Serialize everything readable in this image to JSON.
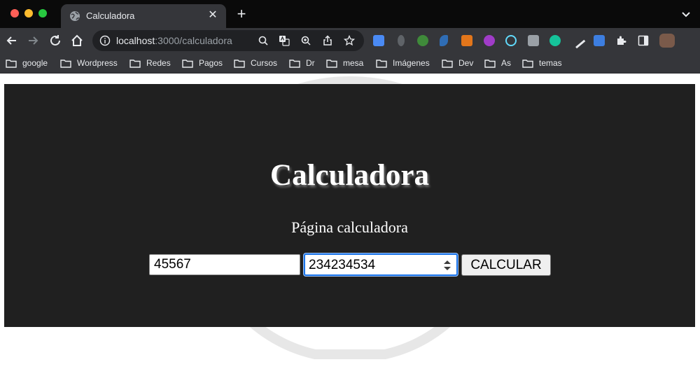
{
  "browser": {
    "tab": {
      "title": "Calculadora"
    },
    "omnibox": {
      "host": "localhost",
      "path": ":3000/calculadora"
    },
    "bookmarks": [
      "google",
      "Wordpress",
      "Redes",
      "Pagos",
      "Cursos",
      "Dr",
      "mesa",
      "Imágenes",
      "Dev",
      "As",
      "temas"
    ]
  },
  "page": {
    "title": "Calculadora",
    "subtitle": "Página calculadora",
    "form": {
      "input1_value": "45567",
      "input2_value": "234234534",
      "button_label": "CALCULAR"
    }
  },
  "colors": {
    "app_background": "#202020",
    "focus_ring": "#1a73e8",
    "chrome_dark": "#35363a"
  },
  "icons": [
    "globe-icon",
    "close-icon",
    "plus-icon",
    "back-arrow-icon",
    "forward-arrow-icon",
    "reload-icon",
    "home-icon",
    "info-icon",
    "zoom-icon",
    "translate-icon",
    "share-icon",
    "star-icon",
    "extensions-icon",
    "sidepanel-icon",
    "folder-icon",
    "chevron-down-icon"
  ]
}
